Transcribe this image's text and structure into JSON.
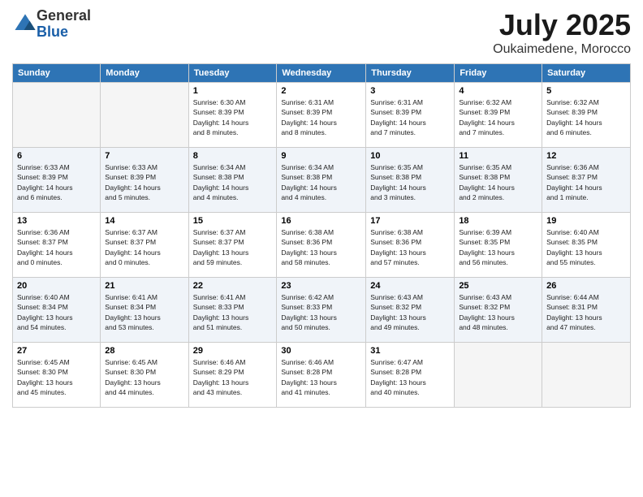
{
  "header": {
    "logo_general": "General",
    "logo_blue": "Blue",
    "title": "July 2025",
    "location": "Oukaimedene, Morocco"
  },
  "columns": [
    "Sunday",
    "Monday",
    "Tuesday",
    "Wednesday",
    "Thursday",
    "Friday",
    "Saturday"
  ],
  "weeks": [
    {
      "days": [
        {
          "num": "",
          "info": ""
        },
        {
          "num": "",
          "info": ""
        },
        {
          "num": "1",
          "info": "Sunrise: 6:30 AM\nSunset: 8:39 PM\nDaylight: 14 hours\nand 8 minutes."
        },
        {
          "num": "2",
          "info": "Sunrise: 6:31 AM\nSunset: 8:39 PM\nDaylight: 14 hours\nand 8 minutes."
        },
        {
          "num": "3",
          "info": "Sunrise: 6:31 AM\nSunset: 8:39 PM\nDaylight: 14 hours\nand 7 minutes."
        },
        {
          "num": "4",
          "info": "Sunrise: 6:32 AM\nSunset: 8:39 PM\nDaylight: 14 hours\nand 7 minutes."
        },
        {
          "num": "5",
          "info": "Sunrise: 6:32 AM\nSunset: 8:39 PM\nDaylight: 14 hours\nand 6 minutes."
        }
      ]
    },
    {
      "days": [
        {
          "num": "6",
          "info": "Sunrise: 6:33 AM\nSunset: 8:39 PM\nDaylight: 14 hours\nand 6 minutes."
        },
        {
          "num": "7",
          "info": "Sunrise: 6:33 AM\nSunset: 8:39 PM\nDaylight: 14 hours\nand 5 minutes."
        },
        {
          "num": "8",
          "info": "Sunrise: 6:34 AM\nSunset: 8:38 PM\nDaylight: 14 hours\nand 4 minutes."
        },
        {
          "num": "9",
          "info": "Sunrise: 6:34 AM\nSunset: 8:38 PM\nDaylight: 14 hours\nand 4 minutes."
        },
        {
          "num": "10",
          "info": "Sunrise: 6:35 AM\nSunset: 8:38 PM\nDaylight: 14 hours\nand 3 minutes."
        },
        {
          "num": "11",
          "info": "Sunrise: 6:35 AM\nSunset: 8:38 PM\nDaylight: 14 hours\nand 2 minutes."
        },
        {
          "num": "12",
          "info": "Sunrise: 6:36 AM\nSunset: 8:37 PM\nDaylight: 14 hours\nand 1 minute."
        }
      ]
    },
    {
      "days": [
        {
          "num": "13",
          "info": "Sunrise: 6:36 AM\nSunset: 8:37 PM\nDaylight: 14 hours\nand 0 minutes."
        },
        {
          "num": "14",
          "info": "Sunrise: 6:37 AM\nSunset: 8:37 PM\nDaylight: 14 hours\nand 0 minutes."
        },
        {
          "num": "15",
          "info": "Sunrise: 6:37 AM\nSunset: 8:37 PM\nDaylight: 13 hours\nand 59 minutes."
        },
        {
          "num": "16",
          "info": "Sunrise: 6:38 AM\nSunset: 8:36 PM\nDaylight: 13 hours\nand 58 minutes."
        },
        {
          "num": "17",
          "info": "Sunrise: 6:38 AM\nSunset: 8:36 PM\nDaylight: 13 hours\nand 57 minutes."
        },
        {
          "num": "18",
          "info": "Sunrise: 6:39 AM\nSunset: 8:35 PM\nDaylight: 13 hours\nand 56 minutes."
        },
        {
          "num": "19",
          "info": "Sunrise: 6:40 AM\nSunset: 8:35 PM\nDaylight: 13 hours\nand 55 minutes."
        }
      ]
    },
    {
      "days": [
        {
          "num": "20",
          "info": "Sunrise: 6:40 AM\nSunset: 8:34 PM\nDaylight: 13 hours\nand 54 minutes."
        },
        {
          "num": "21",
          "info": "Sunrise: 6:41 AM\nSunset: 8:34 PM\nDaylight: 13 hours\nand 53 minutes."
        },
        {
          "num": "22",
          "info": "Sunrise: 6:41 AM\nSunset: 8:33 PM\nDaylight: 13 hours\nand 51 minutes."
        },
        {
          "num": "23",
          "info": "Sunrise: 6:42 AM\nSunset: 8:33 PM\nDaylight: 13 hours\nand 50 minutes."
        },
        {
          "num": "24",
          "info": "Sunrise: 6:43 AM\nSunset: 8:32 PM\nDaylight: 13 hours\nand 49 minutes."
        },
        {
          "num": "25",
          "info": "Sunrise: 6:43 AM\nSunset: 8:32 PM\nDaylight: 13 hours\nand 48 minutes."
        },
        {
          "num": "26",
          "info": "Sunrise: 6:44 AM\nSunset: 8:31 PM\nDaylight: 13 hours\nand 47 minutes."
        }
      ]
    },
    {
      "days": [
        {
          "num": "27",
          "info": "Sunrise: 6:45 AM\nSunset: 8:30 PM\nDaylight: 13 hours\nand 45 minutes."
        },
        {
          "num": "28",
          "info": "Sunrise: 6:45 AM\nSunset: 8:30 PM\nDaylight: 13 hours\nand 44 minutes."
        },
        {
          "num": "29",
          "info": "Sunrise: 6:46 AM\nSunset: 8:29 PM\nDaylight: 13 hours\nand 43 minutes."
        },
        {
          "num": "30",
          "info": "Sunrise: 6:46 AM\nSunset: 8:28 PM\nDaylight: 13 hours\nand 41 minutes."
        },
        {
          "num": "31",
          "info": "Sunrise: 6:47 AM\nSunset: 8:28 PM\nDaylight: 13 hours\nand 40 minutes."
        },
        {
          "num": "",
          "info": ""
        },
        {
          "num": "",
          "info": ""
        }
      ]
    }
  ]
}
